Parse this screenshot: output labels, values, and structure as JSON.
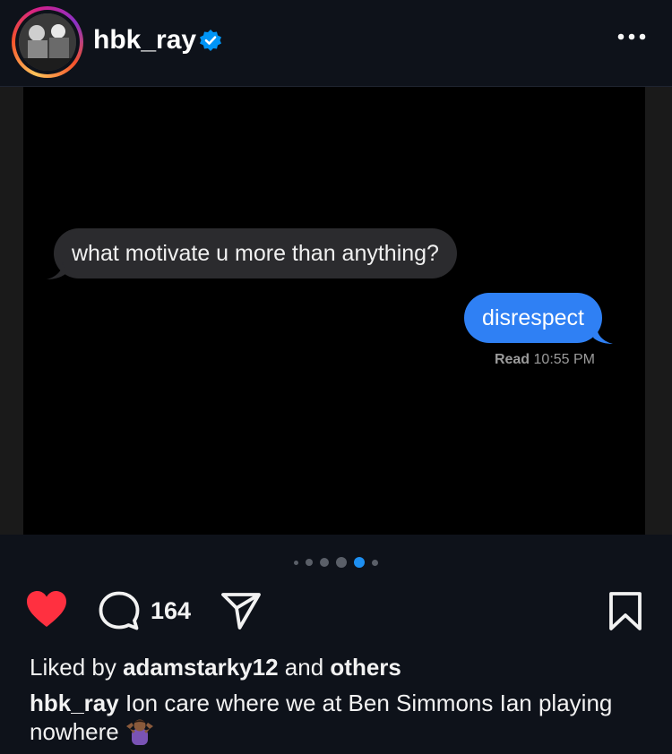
{
  "post": {
    "username": "hbk_ray",
    "verified": true
  },
  "media": {
    "incoming_message": "what motivate u more than anything?",
    "outgoing_message": "disrespect",
    "read_label": "Read",
    "read_time": "10:55 PM"
  },
  "carousel": {
    "count": 6,
    "active_index": 4
  },
  "actions": {
    "liked": true,
    "comment_count": "164"
  },
  "likes": {
    "prefix": "Liked by",
    "user": "adamstarky12",
    "joiner": "and",
    "others": "others"
  },
  "caption": {
    "username": "hbk_ray",
    "text": "Ion care where we at Ben Simmons Ian playing nowhere",
    "emoji_icon": "person-shrugging-emoji"
  },
  "icons": {
    "more": "more-options-icon",
    "like": "heart-icon",
    "comment": "comment-icon",
    "share": "send-icon",
    "save": "bookmark-icon"
  },
  "colors": {
    "background": "#0e121a",
    "like": "#ff3040",
    "verified": "#0095f6",
    "bubble_out": "#2f80f4",
    "bubble_in": "#2b2b2e",
    "carousel_active": "#1d8ff1"
  }
}
